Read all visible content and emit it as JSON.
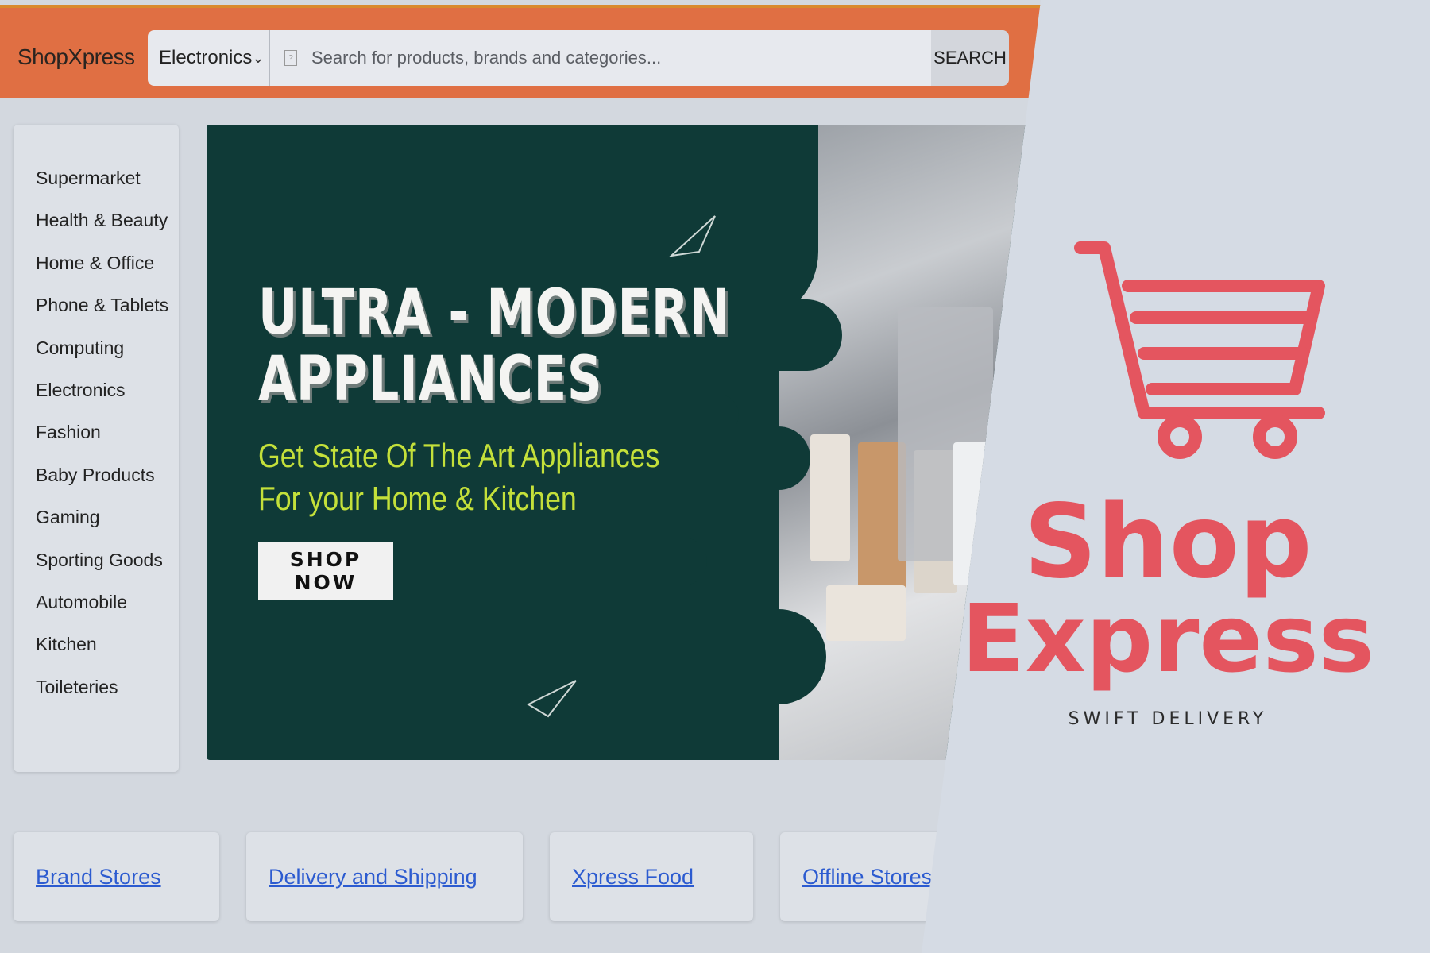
{
  "header": {
    "brand": "ShopXpress",
    "category_select": "Electronics",
    "search_placeholder": "Search for products, brands and categories...",
    "search_button": "SEARCH"
  },
  "sidebar": {
    "items": [
      {
        "label": "Supermarket"
      },
      {
        "label": "Health & Beauty"
      },
      {
        "label": "Home & Office"
      },
      {
        "label": "Phone & Tablets"
      },
      {
        "label": "Computing"
      },
      {
        "label": "Electronics"
      },
      {
        "label": "Fashion"
      },
      {
        "label": "Baby Products"
      },
      {
        "label": "Gaming"
      },
      {
        "label": "Sporting Goods"
      },
      {
        "label": "Automobile"
      },
      {
        "label": "Kitchen"
      },
      {
        "label": "Toileteries"
      }
    ]
  },
  "banner": {
    "headline_line1": "ULTRA - MODERN",
    "headline_line2": "APPLIANCES",
    "sub_line1": "Get State Of The Art Appliances",
    "sub_line2": "For your Home & Kitchen",
    "cta": "SHOP NOW"
  },
  "footer_links": [
    {
      "label": "Brand Stores"
    },
    {
      "label": "Delivery and Shipping"
    },
    {
      "label": "Xpress Food"
    },
    {
      "label": "Offline Stores"
    }
  ],
  "logo": {
    "word1": "Shop",
    "word2": "Express",
    "tagline": "SWIFT DELIVERY",
    "icon": "shopping-cart-icon"
  },
  "colors": {
    "header_bg": "#e06f43",
    "banner_bg": "#0f3a37",
    "banner_accent": "#c4e03a",
    "logo_red": "#e4555f",
    "link_blue": "#2c5bd0"
  }
}
